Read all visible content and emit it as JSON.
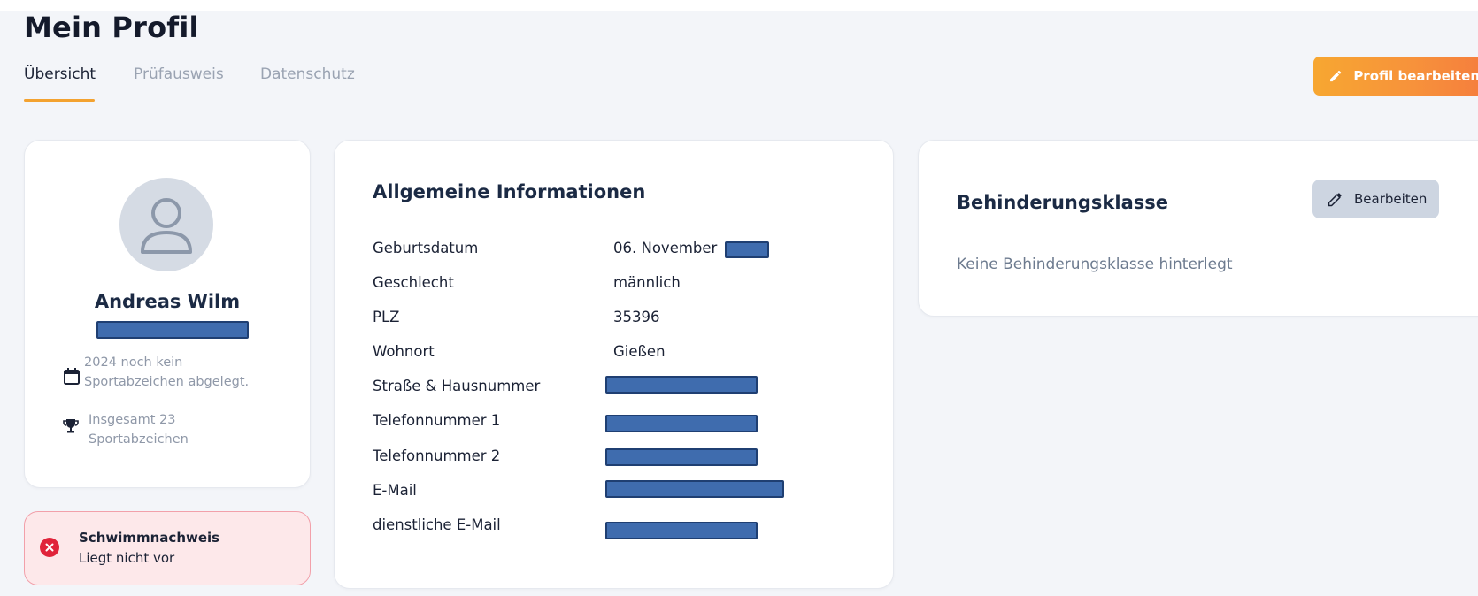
{
  "page": {
    "title": "Mein Profil"
  },
  "tabs": [
    {
      "label": "Übersicht",
      "active": true
    },
    {
      "label": "Prüfausweis",
      "active": false
    },
    {
      "label": "Datenschutz",
      "active": false
    }
  ],
  "edit_profile_button": {
    "label": "Profil bearbeiten",
    "icon": "pencil-icon"
  },
  "profile": {
    "name": "Andreas Wilm",
    "stats": [
      {
        "icon": "calendar-icon",
        "line1": "2024 noch kein",
        "line2": "Sportabzeichen abgelegt."
      },
      {
        "icon": "trophy-icon",
        "line1": "Insgesamt 23",
        "line2": "Sportabzeichen"
      }
    ]
  },
  "swim_proof": {
    "icon": "x-circle-icon",
    "title": "Schwimmnachweis",
    "status": "Liegt nicht vor"
  },
  "general_info": {
    "title": "Allgemeine Informationen",
    "rows": [
      {
        "label": "Geburtsdatum",
        "value": "06. November"
      },
      {
        "label": "Geschlecht",
        "value": "männlich"
      },
      {
        "label": "PLZ",
        "value": "35396"
      },
      {
        "label": "Wohnort",
        "value": "Gießen"
      },
      {
        "label": "Straße & Hausnummer",
        "value": ""
      },
      {
        "label": "Telefonnummer 1",
        "value": ""
      },
      {
        "label": "Telefonnummer 2",
        "value": ""
      },
      {
        "label": "E-Mail",
        "value": ""
      },
      {
        "label": "dienstliche E-Mail",
        "value": ""
      }
    ]
  },
  "disability_class": {
    "title": "Behinderungsklasse",
    "edit_label": "Bearbeiten",
    "empty_text": "Keine Behinderungsklasse hinterlegt"
  },
  "colors": {
    "accent_orange": "#f7923b",
    "tab_underline": "#f3a230",
    "error_red": "#e0233a",
    "redaction_blue": "#3f6cae"
  }
}
